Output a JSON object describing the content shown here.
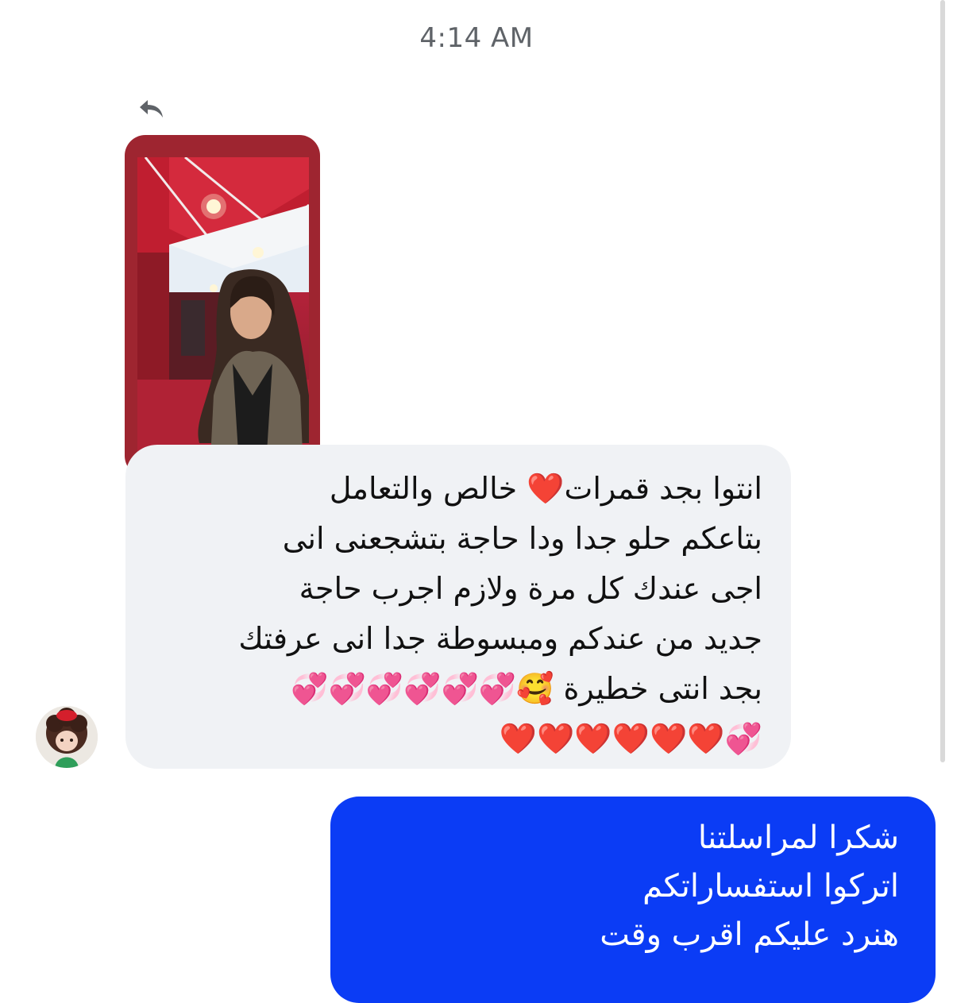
{
  "conversation": {
    "timestamp": "4:14 AM"
  },
  "story_reply": {
    "icon": "reply-arrow-icon",
    "card_color": "#9e2530"
  },
  "incoming_message": {
    "lines": [
      "انتوا بجد قمرات❤️ خالص والتعامل",
      "بتاعكم حلو جدا ودا حاجة بتشجعنى انى",
      "اجى عندك كل مرة ولازم اجرب حاجة",
      "جديد من عندكم ومبسوطة جدا انى عرفتك",
      "بجد انتى خطيرة 🥰💞💞💞💞💞💞",
      "💞❤️❤️❤️❤️❤️❤️"
    ],
    "bubble_color": "#f0f2f5"
  },
  "outgoing_message": {
    "lines": [
      "شكرا لمراسلتنا",
      "اتركوا استفساراتكم",
      "هنرد عليكم اقرب وقت"
    ],
    "bubble_color": "#0b3cf5"
  }
}
